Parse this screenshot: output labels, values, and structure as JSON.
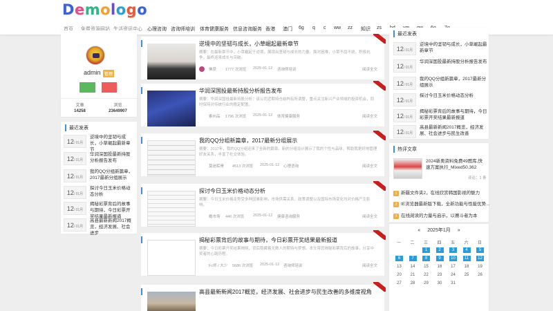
{
  "logo": "Demologo",
  "nav": [
    "首页",
    "免费资源网站",
    "生活资讯中心",
    "心理咨询",
    "咨询师培训",
    "体育健康服务",
    "信息咨询服务",
    "香港",
    "澳门",
    "6g",
    "q",
    "c",
    "ww",
    "zz",
    "知识",
    "zs",
    "bd",
    "ym",
    "qw",
    "6g",
    "7g"
  ],
  "user": {
    "name": "admin",
    "badge": "管理",
    "stats": [
      {
        "label": "文章",
        "value": "14258"
      },
      {
        "label": "浏览",
        "value": "23649907"
      }
    ]
  },
  "sidebar_recent": {
    "title": "最近发表",
    "items": [
      {
        "day": "12",
        "month": "/ 01月",
        "title": "逆境中的坚韧与成长，小草崛起最新章节"
      },
      {
        "day": "12",
        "month": "/ 01月",
        "title": "华润深国投最新持股分析报告发布"
      },
      {
        "day": "12",
        "month": "/ 01月",
        "title": "我的QQ分组新篇章，2017最新分组展示"
      },
      {
        "day": "12",
        "month": "/ 01月",
        "title": "探讨今日玉米价格动态分析"
      },
      {
        "day": "12",
        "month": "/ 01月",
        "title": "揭秘彩票背后的故事与期待，今日彩票开奖结果最新报道"
      },
      {
        "day": "12",
        "month": "/ 01月",
        "title": "高县最新新闻2017概览，经济发展、社会进步"
      }
    ]
  },
  "articles": [
    {
      "title": "逆境中的坚韧与成长，小草崛起最新章节",
      "excerpt": "摘要：在最新章节中，小草崛起于逆境，展现出坚韧与成长的力量。面对困难，小草不屈不挠，积极抗争，最终迎来成长与突破。",
      "author": "佛获",
      "views": "1777 次浏览",
      "date": "2025-01-12",
      "cat": "咨询师培训",
      "read": "阅读全文"
    },
    {
      "title": "华润深国投最新持股分析报告发布",
      "excerpt": "摘要：华润深国投最新持股分析：该公司近期持仓结构有所调整，重点关注新兴产业领域的投资机会，同时保持对传统行业的稳定配置。",
      "author": "素州品",
      "views": "1796 次浏览",
      "date": "2025-01-12",
      "cat": "体育健康服务",
      "read": "阅读全文"
    },
    {
      "title": "我的QQ分组新篇章，2017最新分组展示",
      "excerpt": "摘要：2017年，我的QQ分组迎来了全新的篇章。新的分组设计展示了我的个性与品味，帮助我更好地管理好友关系，丰富了社交体验。",
      "author": "莫迷粽骨",
      "views": "4513 次浏览",
      "date": "2025-01-12",
      "cat": "心理咨询",
      "read": "阅读全文"
    },
    {
      "title": "探讨今日玉米价格动态分析",
      "excerpt": "摘要：今日玉米价格走势受多种因素影响，市场供需关系、政策调整以及国际市场变化均对价格产生影响。",
      "author": "概市场",
      "views": "446 次浏览",
      "date": "2025-01-12",
      "cat": "健康咨询服务",
      "read": "阅读全文"
    },
    {
      "title": "揭秘彩票背后的故事与期待，今日彩票开奖结果最新报道",
      "excerpt": "摘要：今日彩票开奖结果揭晓，背后隐藏着无数人的期待与梦想。本文带您揭秘彩票背后的故事，分享中奖者的心路历程。",
      "author": "Fc师 / 大少",
      "views": "5686 次浏览",
      "date": "2025-01-12",
      "cat": "咨询师培训",
      "read": "阅读全文"
    },
    {
      "title": "高县最新新闻2017概览，经济发展、社会进步与民生改善的多维度视角",
      "excerpt": "",
      "author": "",
      "views": "",
      "date": "",
      "cat": "",
      "read": ""
    }
  ],
  "right_recent": {
    "title": "最近发表",
    "items": [
      {
        "day": "12",
        "month": "/ 01月",
        "title": "逆境中的坚韧与成长，小草崛起最新章节"
      },
      {
        "day": "12",
        "month": "/ 01月",
        "title": "华润深国投最新持股分析报告发布"
      },
      {
        "day": "12",
        "month": "/ 01月",
        "title": "我的QQ分组新篇章，2017最新分组展示"
      },
      {
        "day": "12",
        "month": "/ 01月",
        "title": "探讨今日玉米价格动态分析"
      },
      {
        "day": "12",
        "month": "/ 01月",
        "title": "揭秘彩票背后的故事与期待，今日彩票开奖结果最新报道"
      },
      {
        "day": "12",
        "month": "/ 01月",
        "title": "高县最新新闻2017概览，经济发展、社会进步与民生改善"
      }
    ]
  },
  "hot": {
    "title": "热评文章",
    "featured": "2024新奥资料免费49图库,快速方案执行_Mixed50.362",
    "featured_comments": "评论：1 条",
    "items": [
      "新疆文件夹2，在线欣赏韩国影视的魅力",
      "IE浏览器最新版下载，全新功能与性能优势...",
      "在线阅读的力量与启示，以赛斗者为本"
    ]
  },
  "calendar": {
    "prev": "«",
    "next": "»",
    "title": "2025年1月",
    "weekdays": [
      "一",
      "二",
      "三",
      "四",
      "五",
      "六",
      "日"
    ],
    "days": [
      "",
      "",
      "1",
      "2",
      "3",
      "4",
      "5",
      "6",
      "7",
      "8",
      "9",
      "10",
      "11",
      "12",
      "13",
      "14",
      "15",
      "16",
      "17",
      "18",
      "19",
      "20",
      "21",
      "22",
      "23",
      "24",
      "25",
      "26",
      "27",
      "28",
      "29",
      "30",
      "31"
    ],
    "highlight": [
      "1",
      "2",
      "3",
      "4",
      "5",
      "6",
      "7",
      "8",
      "9",
      "10",
      "11",
      "12"
    ]
  },
  "colors": {
    "accent": "#3d8fd8",
    "ribbon": "#c81e1e",
    "badge": "#f0ad4e",
    "btn_green": "#5cb85c",
    "btn_red": "#ef5c5c",
    "cal_highlight": "#2b9bd9"
  }
}
